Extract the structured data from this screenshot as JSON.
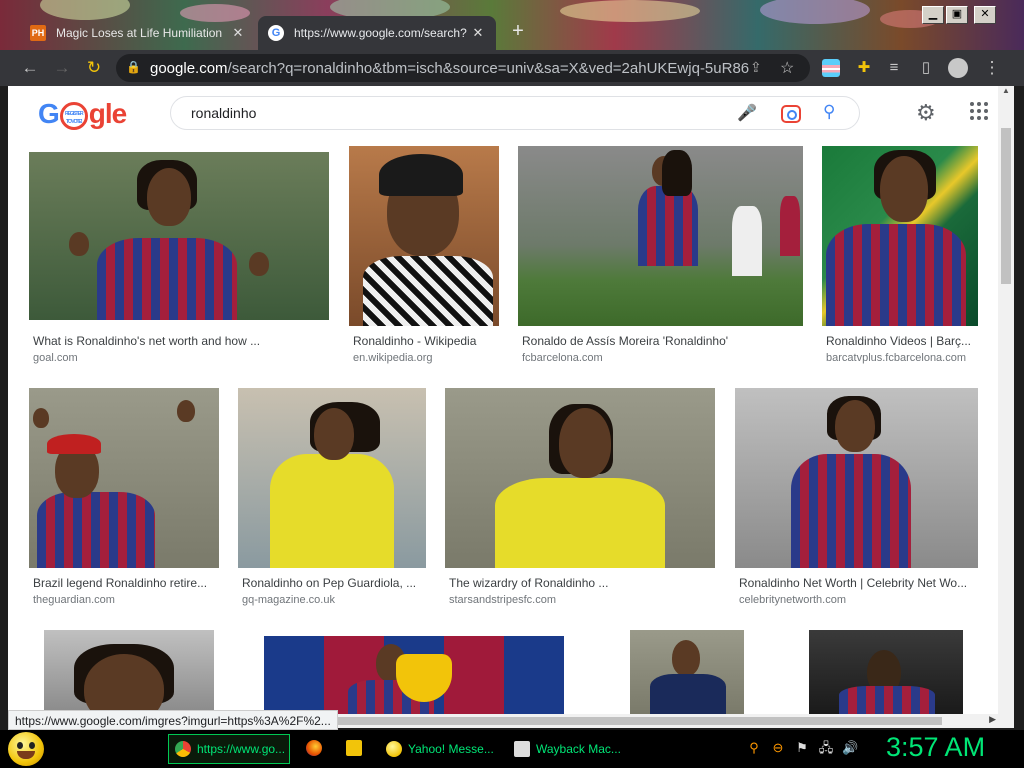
{
  "browser": {
    "tabs": [
      {
        "title": "Magic Loses at Life Humiliation",
        "favicon": "PH",
        "active": false
      },
      {
        "title": "https://www.google.com/search?",
        "favicon": "G",
        "active": true
      }
    ],
    "url_domain": "google.com",
    "url_rest": "/search?q=ronaldinho&tbm=isch&source=univ&sa=X&ved=2ahUKEwjq-5uR86L..."
  },
  "google": {
    "logo_left": "G",
    "logo_doodle": "REGISTER TO VOTE!",
    "logo_right": "gle",
    "query": "ronaldinho"
  },
  "results": [
    {
      "caption": "What is Ronaldinho's net worth and how ...",
      "source": "goal.com"
    },
    {
      "caption": "Ronaldinho - Wikipedia",
      "source": "en.wikipedia.org"
    },
    {
      "caption": "Ronaldo de Assís Moreira 'Ronaldinho'",
      "source": "fcbarcelona.com"
    },
    {
      "caption": "Ronaldinho Videos | Barç...",
      "source": "barcatvplus.fcbarcelona.com"
    },
    {
      "caption": "Brazil legend Ronaldinho retire...",
      "source": "theguardian.com"
    },
    {
      "caption": "Ronaldinho on Pep Guardiola, ...",
      "source": "gq-magazine.co.uk"
    },
    {
      "caption": "The wizardry of Ronaldinho ...",
      "source": "starsandstripesfc.com"
    },
    {
      "caption": "Ronaldinho Net Worth | Celebrity Net Wo...",
      "source": "celebritynetworth.com"
    }
  ],
  "status_url": "https://www.google.com/imgres?imgurl=https%3A%2F%2...",
  "taskbar": {
    "tasks": [
      {
        "label": "https://www.go..."
      },
      {
        "label": "Yahoo! Messe..."
      },
      {
        "label": "Wayback Mac..."
      }
    ],
    "clock": "3:57 AM"
  }
}
